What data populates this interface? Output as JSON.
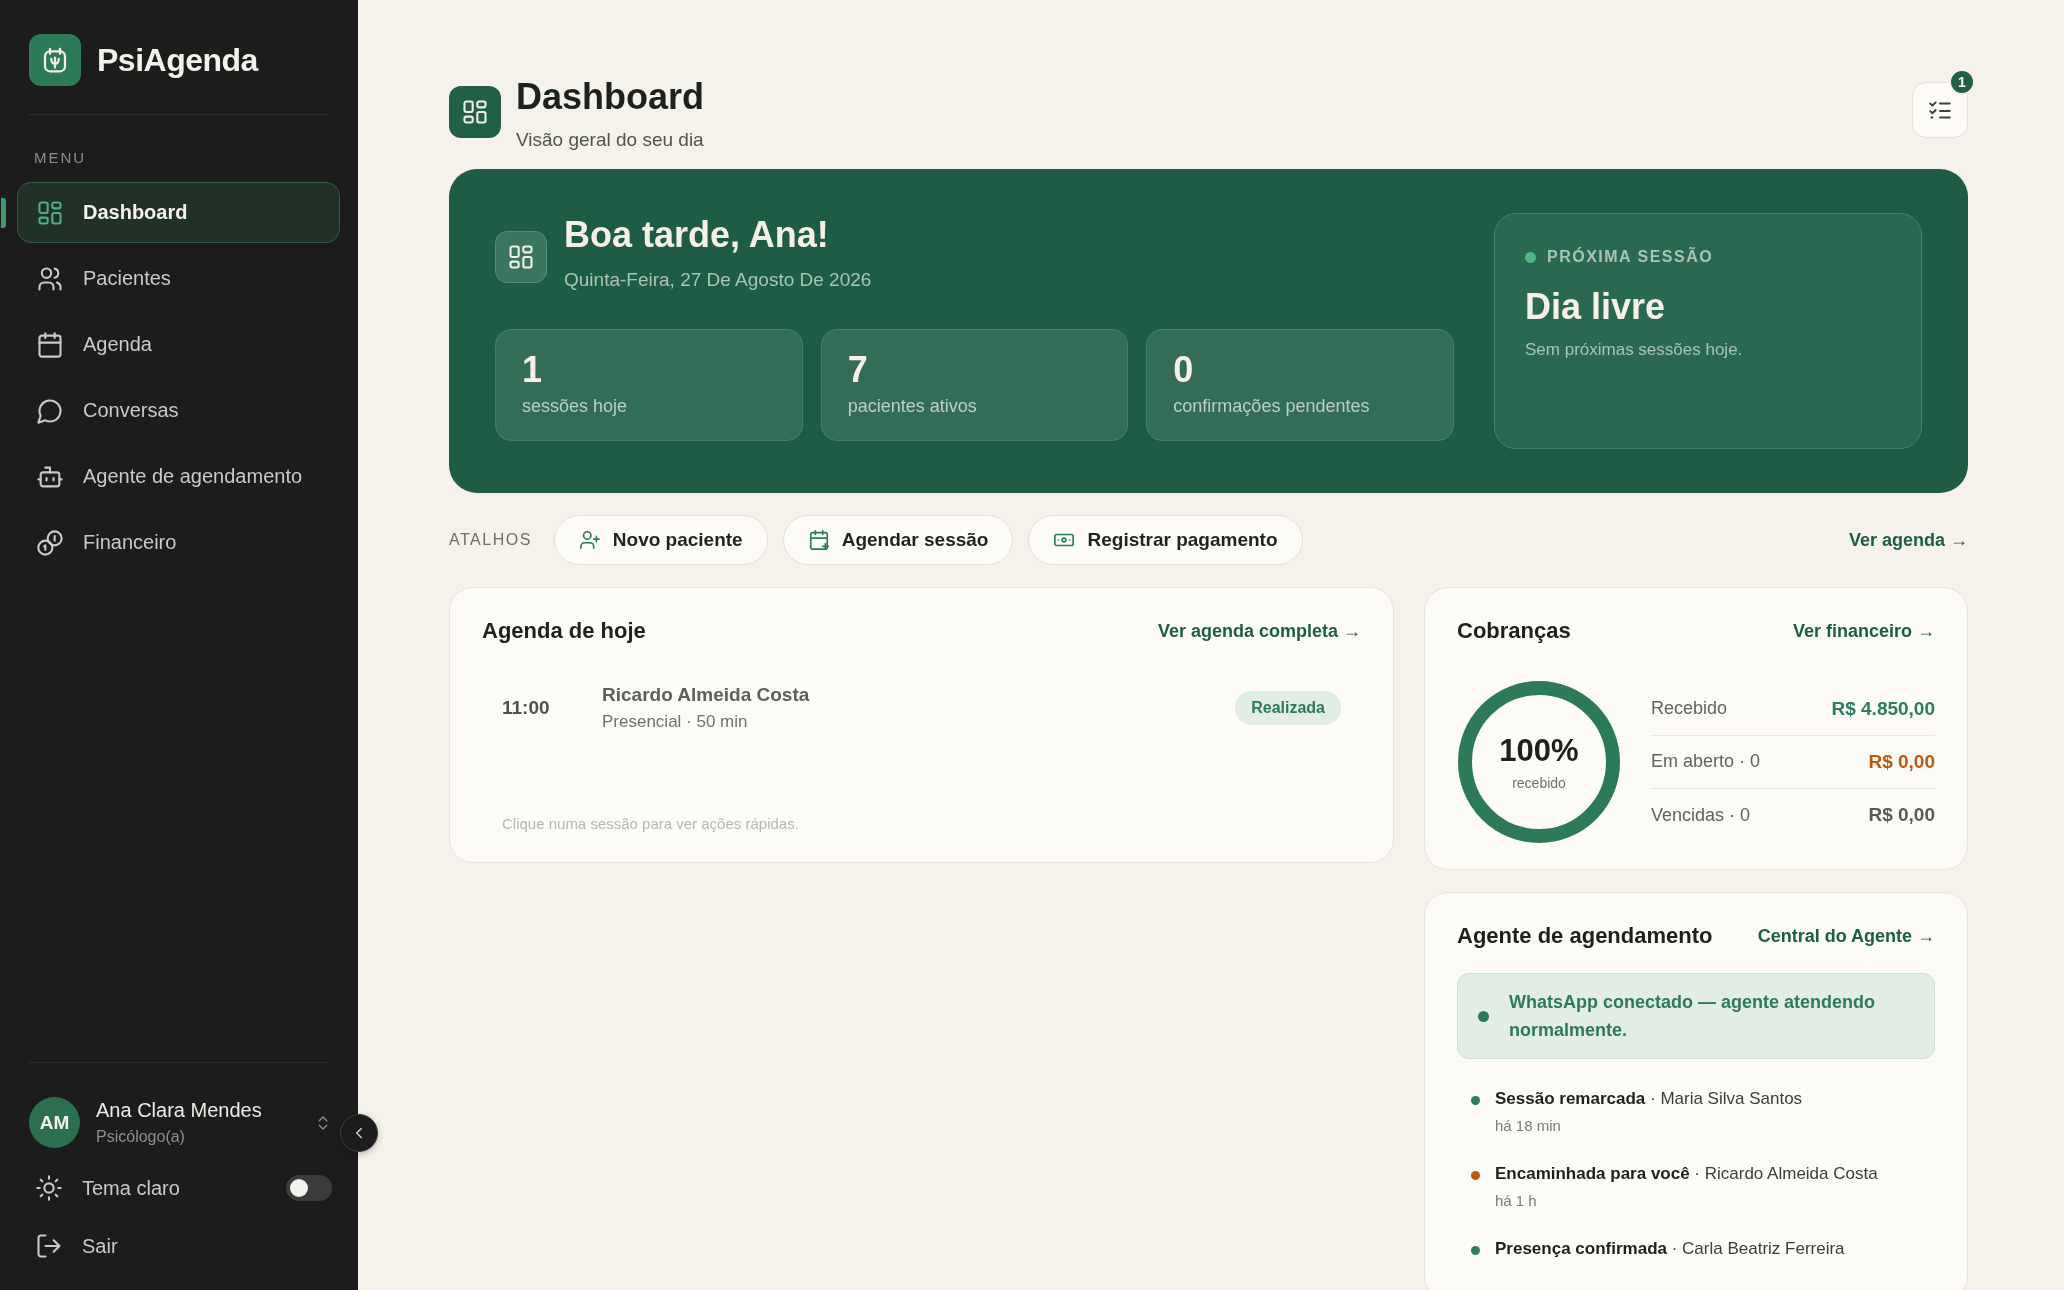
{
  "app": {
    "name": "PsiAgenda"
  },
  "sidebar": {
    "section_label": "MENU",
    "items": [
      {
        "label": "Dashboard",
        "selected": true
      },
      {
        "label": "Pacientes",
        "selected": false
      },
      {
        "label": "Agenda",
        "selected": false
      },
      {
        "label": "Conversas",
        "selected": false
      },
      {
        "label": "Agente de agendamento",
        "selected": false
      },
      {
        "label": "Financeiro",
        "selected": false
      }
    ],
    "user": {
      "initials": "AM",
      "name": "Ana Clara Mendes",
      "role": "Psicólogo(a)"
    },
    "theme_toggle": {
      "label": "Tema claro",
      "on": false
    },
    "logout": {
      "label": "Sair"
    }
  },
  "header": {
    "title": "Dashboard",
    "subtitle": "Visão geral do seu dia",
    "notification_count": "1"
  },
  "hero": {
    "greeting": "Boa tarde, Ana!",
    "date": "Quinta-Feira, 27 De Agosto De 2026",
    "stats": [
      {
        "value": "1",
        "label": "sessões hoje"
      },
      {
        "value": "7",
        "label": "pacientes ativos"
      },
      {
        "value": "0",
        "label": "confirmações pendentes"
      }
    ],
    "next_session": {
      "label": "PRÓXIMA SESSÃO",
      "title": "Dia livre",
      "note": "Sem próximas sessões hoje."
    }
  },
  "shortcuts": {
    "label": "ATALHOS",
    "buttons": [
      "Novo paciente",
      "Agendar sessão",
      "Registrar pagamento"
    ],
    "link": "Ver agenda →"
  },
  "today": {
    "title": "Agenda de hoje",
    "link": "Ver agenda completa →",
    "sessions": [
      {
        "time": "11:00",
        "patient": "Ricardo Almeida Costa",
        "details": "Presencial · 50 min",
        "status": "Realizada"
      }
    ],
    "hint": "Clique numa sessão para ver ações rápidas."
  },
  "billing": {
    "title": "Cobranças",
    "link": "Ver financeiro →",
    "ring": {
      "value": "100%",
      "caption": "recebido",
      "level": 1
    },
    "rows": [
      {
        "label": "Recebido",
        "amount": "R$ 4.850,00",
        "color": "#2e7d5b"
      },
      {
        "label": "Em aberto · 0",
        "amount": "R$ 0,00",
        "color": "#b85c14"
      },
      {
        "label": "Vencidas · 0",
        "amount": "R$ 0,00",
        "color": "#5a5a55"
      }
    ]
  },
  "agent": {
    "title": "Agente de agendamento",
    "link": "Central do Agente →",
    "status": "WhatsApp conectado — agente atendendo normalmente.",
    "events": [
      {
        "text": "**Sessão remarcada** · Maria Silva Santos",
        "time": "há 18 min",
        "color": "#2e7d5b"
      },
      {
        "text": "**Encaminhada para você** · Ricardo Almeida Costa",
        "time": "há 1 h",
        "color": "#b85c14"
      },
      {
        "text": "**Presença confirmada** · Carla Beatriz Ferreira",
        "color": "#2e7d5b"
      }
    ]
  }
}
